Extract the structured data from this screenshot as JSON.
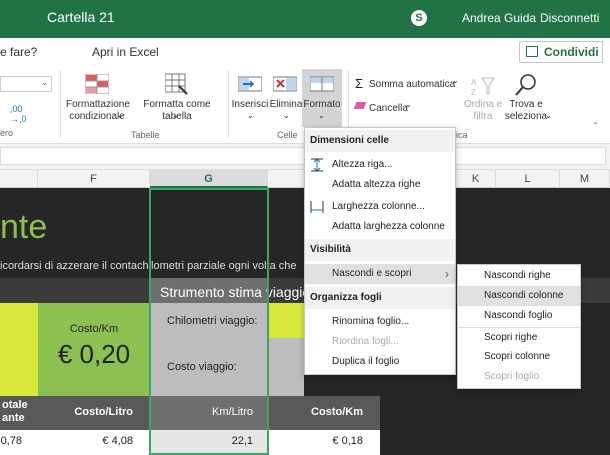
{
  "titlebar": {
    "title": "Cartella 21",
    "user": "Andrea Guida",
    "logout": "Disconnetti"
  },
  "menu": {
    "tell_me": "e fare?",
    "open_excel": "Apri in Excel",
    "share": "Condividi"
  },
  "ribbon": {
    "partial_group": "ero",
    "format_number": ",00\n→,0",
    "cond_format": "Formattazione\ncondizionale",
    "format_table": "Formatta come tabella",
    "tables_group": "Tabelle",
    "insert": "Inserisci",
    "delete": "Elimina",
    "format": "Formato",
    "cells_group": "Celle",
    "autosum": "Somma automatica",
    "clear": "Cancella",
    "sort_filter": "Ordina e\nfiltra",
    "find_select": "Trova e\nseleziona",
    "editing_group": "ica"
  },
  "columns": [
    "F",
    "G",
    "K",
    "L",
    "M"
  ],
  "sheet": {
    "title_fragment": "nte",
    "subtitle": "icordarsi di azzerare il contachilometri parziale ogni volta che si",
    "tool_title": "Strumento stima viaggio",
    "costo_km_label": "Costo/Km",
    "costo_km_value": "€ 0,20",
    "km_viaggio_label": "Chilometri viaggio:",
    "costo_viaggio_label": "Costo viaggio:",
    "hdr_totale": "otale\nante",
    "hdr_costo_litro": "Costo/Litro",
    "hdr_km_litro": "Km/Litro",
    "hdr_costo_km": "Costo/Km",
    "row": [
      "0,78",
      "€ 4,08",
      "22,1",
      "€ 0,18"
    ]
  },
  "format_menu": {
    "h1": "Dimensioni celle",
    "row_height": "Altezza riga...",
    "autofit_rows": "Adatta altezza righe",
    "col_width": "Larghezza colonne...",
    "autofit_cols": "Adatta larghezza colonne",
    "h2": "Visibilità",
    "hide_show": "Nascondi e scopri",
    "h3": "Organizza fogli",
    "rename": "Rinomina foglio...",
    "reorder": "Riordina fogli...",
    "duplicate": "Duplica il foglio"
  },
  "submenu": {
    "hide_rows": "Nascondi righe",
    "hide_cols": "Nascondi colonne",
    "hide_sheet": "Nascondi foglio",
    "show_rows": "Scopri righe",
    "show_cols": "Scopri colonne",
    "show_sheet": "Scopri foglio"
  },
  "colors": {
    "excel_green": "#217346",
    "lime": "#8cc152",
    "yellow": "#d8e83a",
    "dark": "#262626"
  }
}
